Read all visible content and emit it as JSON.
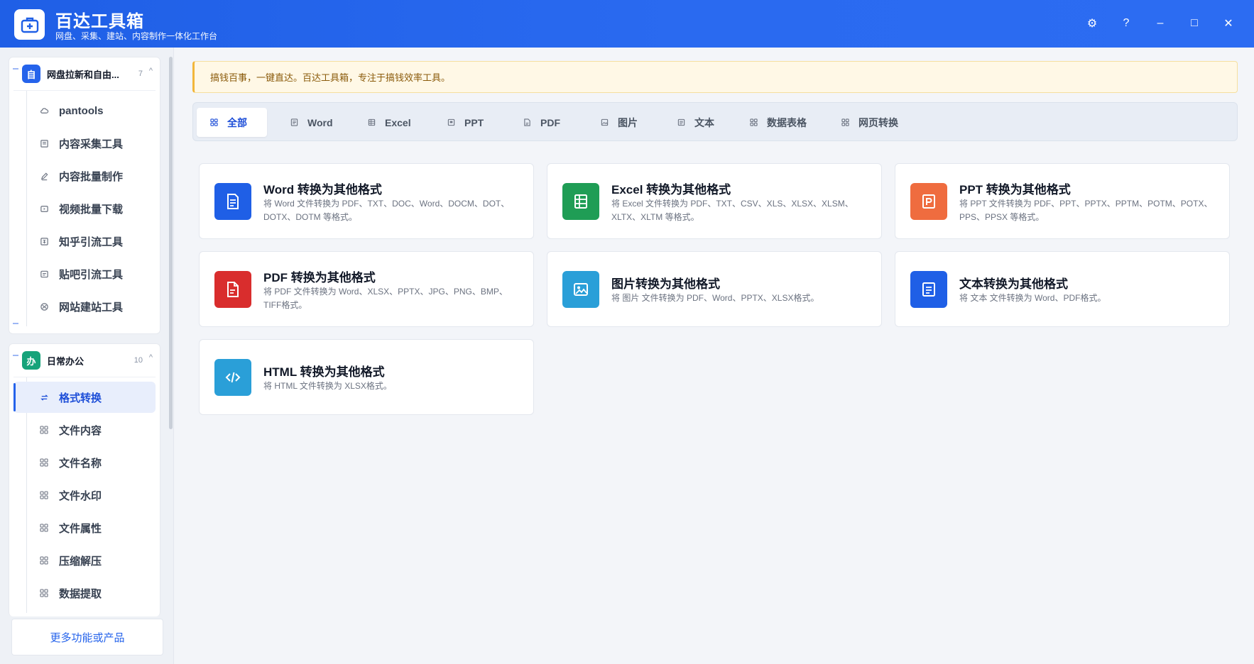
{
  "app": {
    "title": "百达工具箱",
    "subtitle": "网盘、采集、建站、内容制作一体化工作台"
  },
  "window_controls": {
    "settings": "⚙",
    "help": "?",
    "minimize": "–",
    "maximize": "□",
    "close": "✕"
  },
  "sidebar": {
    "groups": [
      {
        "badge": "自",
        "badge_color": "#2563eb",
        "title": "网盘拉新和自由...",
        "count": "7",
        "caret": "^",
        "items": [
          {
            "label": "pantools",
            "icon": "cloud-icon"
          },
          {
            "label": "内容采集工具",
            "icon": "collect-icon"
          },
          {
            "label": "内容批量制作",
            "icon": "pen-icon"
          },
          {
            "label": "视频批量下载",
            "icon": "video-icon"
          },
          {
            "label": "知乎引流工具",
            "icon": "zhihu-icon"
          },
          {
            "label": "贴吧引流工具",
            "icon": "chat-icon"
          },
          {
            "label": "网站建站工具",
            "icon": "globe-icon"
          }
        ]
      },
      {
        "badge": "办",
        "badge_color": "#16a37a",
        "title": "日常办公",
        "count": "10",
        "caret": "^",
        "items": [
          {
            "label": "格式转换",
            "icon": "swap-icon"
          },
          {
            "label": "文件内容",
            "icon": "grid-icon"
          },
          {
            "label": "文件名称",
            "icon": "grid-icon"
          },
          {
            "label": "文件水印",
            "icon": "grid-icon"
          },
          {
            "label": "文件属性",
            "icon": "grid-icon"
          },
          {
            "label": "压缩解压",
            "icon": "grid-icon"
          },
          {
            "label": "数据提取",
            "icon": "grid-icon"
          }
        ]
      }
    ],
    "more_label": "更多功能或产品"
  },
  "notice": "搞钱百事，一键直达。百达工具箱，专注于搞钱效率工具。",
  "tabs": [
    {
      "label": "全部",
      "icon": "grid-icon"
    },
    {
      "label": "Word",
      "icon": "doc-icon"
    },
    {
      "label": "Excel",
      "icon": "table-icon"
    },
    {
      "label": "PPT",
      "icon": "slides-icon"
    },
    {
      "label": "PDF",
      "icon": "pdf-icon"
    },
    {
      "label": "图片",
      "icon": "image-icon"
    },
    {
      "label": "文本",
      "icon": "text-icon"
    },
    {
      "label": "数据表格",
      "icon": "grid-icon"
    },
    {
      "label": "网页转换",
      "icon": "grid-icon"
    }
  ],
  "cards": [
    {
      "title": "Word 转换为其他格式",
      "desc": "将 Word 文件转换为 PDF、TXT、DOC、Word、DOCM、DOT、DOTX、DOTM 等格式。",
      "color": "#1f5fe6",
      "icon": "word-doc-icon"
    },
    {
      "title": "Excel 转换为其他格式",
      "desc": "将 Excel 文件转换为 PDF、TXT、CSV、XLS、XLSX、XLSM、XLTX、XLTM 等格式。",
      "color": "#1f9d55",
      "icon": "excel-sheet-icon"
    },
    {
      "title": "PPT 转换为其他格式",
      "desc": "将 PPT 文件转换为 PDF、PPT、PPTX、PPTM、POTM、POTX、PPS、PPSX 等格式。",
      "color": "#ef6c3f",
      "icon": "ppt-slide-icon"
    },
    {
      "title": "PDF 转换为其他格式",
      "desc": "将 PDF 文件转换为 Word、XLSX、PPTX、JPG、PNG、BMP、TIFF格式。",
      "color": "#d92d2d",
      "icon": "pdf-file-icon"
    },
    {
      "title": "图片转换为其他格式",
      "desc": "将 图片 文件转换为 PDF、Word、PPTX、XLSX格式。",
      "color": "#2a9fd8",
      "icon": "picture-icon"
    },
    {
      "title": "文本转换为其他格式",
      "desc": "将 文本 文件转换为 Word、PDF格式。",
      "color": "#1f5fe6",
      "icon": "text-file-icon"
    },
    {
      "title": "HTML 转换为其他格式",
      "desc": "将 HTML 文件转换为 XLSX格式。",
      "color": "#2a9fd8",
      "icon": "code-icon"
    }
  ]
}
